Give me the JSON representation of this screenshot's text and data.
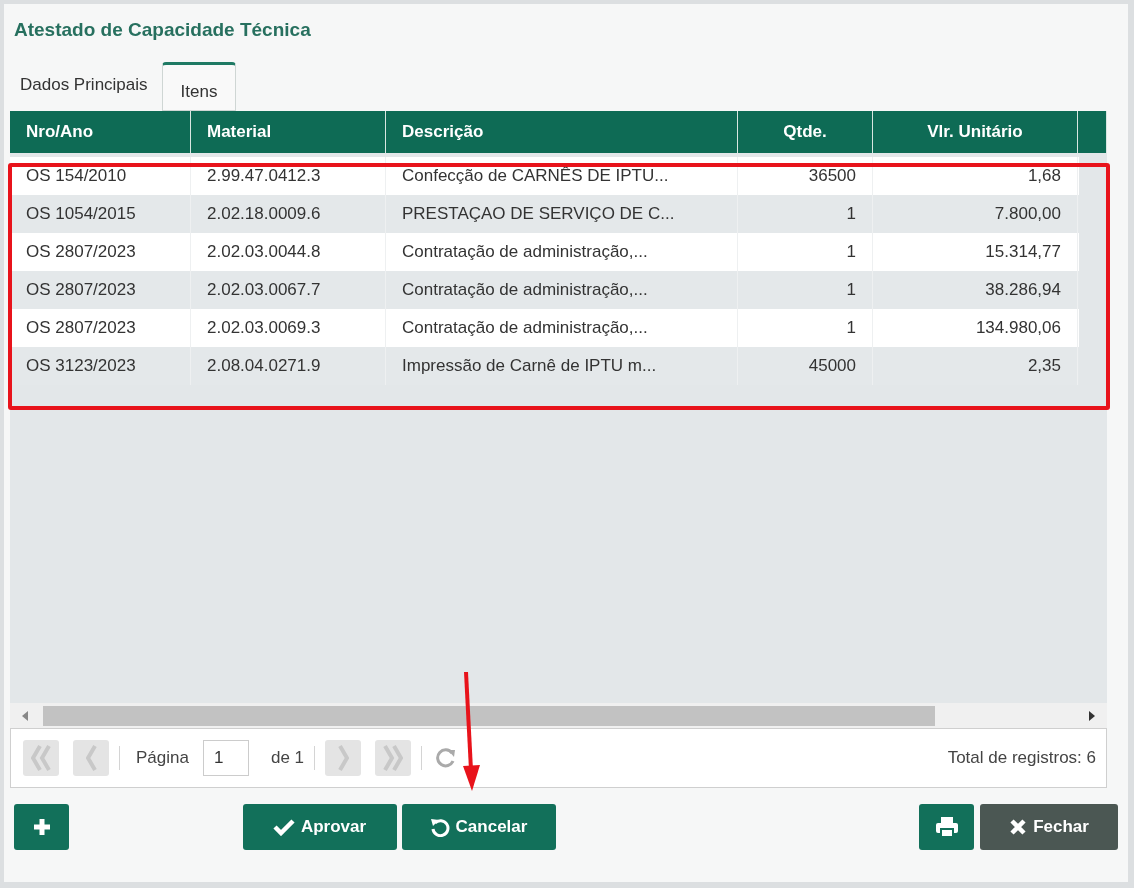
{
  "window": {
    "title": "Atestado de Capacidade Técnica"
  },
  "tabs": [
    {
      "label": "Dados Principais",
      "selected": false
    },
    {
      "label": "Itens",
      "selected": true
    }
  ],
  "table": {
    "columns": [
      {
        "label": "Nro/Ano"
      },
      {
        "label": "Material"
      },
      {
        "label": "Descrição"
      },
      {
        "label": "Qtde."
      },
      {
        "label": "Vlr. Unitário"
      }
    ],
    "rows": [
      {
        "cells": [
          "OS 154/2010",
          "2.99.47.0412.3",
          "Confecção de CARNÊS DE IPTU...",
          "36500",
          "1,68"
        ]
      },
      {
        "cells": [
          "OS 1054/2015",
          "2.02.18.0009.6",
          "PRESTAÇAO DE SERVIÇO DE C...",
          "1",
          "7.800,00"
        ]
      },
      {
        "cells": [
          "OS 2807/2023",
          "2.02.03.0044.8",
          "Contratação de administração,...",
          "1",
          "15.314,77"
        ]
      },
      {
        "cells": [
          "OS 2807/2023",
          "2.02.03.0067.7",
          "Contratação de administração,...",
          "1",
          "38.286,94"
        ]
      },
      {
        "cells": [
          "OS 2807/2023",
          "2.02.03.0069.3",
          "Contratação de administração,...",
          "1",
          "134.980,06"
        ]
      },
      {
        "cells": [
          "OS 3123/2023",
          "2.08.04.0271.9",
          "Impressão de Carnê de IPTU m...",
          "45000",
          "2,35"
        ]
      }
    ]
  },
  "pager": {
    "page_label": "Página",
    "page_value": "1",
    "page_of": "de 1",
    "total": "Total de registros: 6",
    "disabled": true
  },
  "buttons": [
    {
      "kind": "add"
    },
    {
      "kind": "approve",
      "label": "Aprovar"
    },
    {
      "kind": "cancel",
      "label": "Cancelar"
    },
    {
      "kind": "print"
    },
    {
      "kind": "close",
      "label": "Fechar"
    }
  ]
}
